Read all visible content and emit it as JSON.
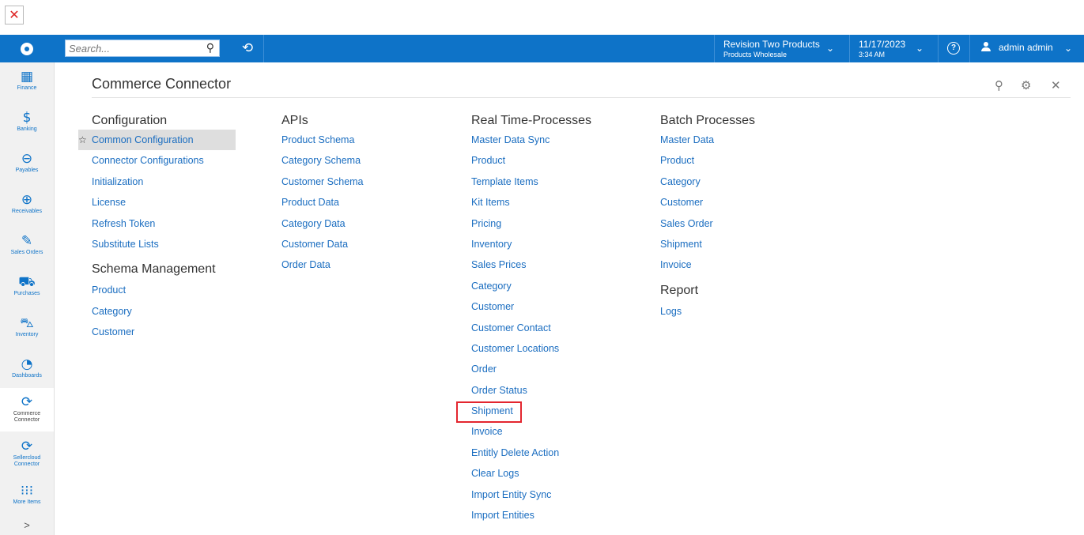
{
  "topbar": {
    "search_placeholder": "Search...",
    "company_name": "Revision Two Products",
    "company_branch": "Products Wholesale",
    "date": "11/17/2023",
    "time": "3:34 AM",
    "user_name": "admin admin",
    "brand_color": "#0e73c8"
  },
  "sidebar": {
    "items": [
      {
        "label": "Finance",
        "icon": "calculator-icon"
      },
      {
        "label": "Banking",
        "icon": "dollar-icon"
      },
      {
        "label": "Payables",
        "icon": "minus-circle-icon"
      },
      {
        "label": "Receivables",
        "icon": "plus-circle-icon"
      },
      {
        "label": "Sales Orders",
        "icon": "edit-icon"
      },
      {
        "label": "Purchases",
        "icon": "cart-icon"
      },
      {
        "label": "Inventory",
        "icon": "truck-icon"
      },
      {
        "label": "Dashboards",
        "icon": "gauge-icon"
      },
      {
        "label": "Commerce Connector",
        "icon": "sync-icon"
      },
      {
        "label": "Sellercloud Connector",
        "icon": "sync-icon"
      },
      {
        "label": "More Items",
        "icon": "grid-icon"
      }
    ],
    "expand_glyph": ">"
  },
  "page": {
    "title": "Commerce Connector"
  },
  "columns": [
    {
      "sections": [
        {
          "heading": "Configuration",
          "links": [
            "Common Configuration",
            "Connector Configurations",
            "Initialization",
            "License",
            "Refresh Token",
            "Substitute Lists"
          ]
        },
        {
          "heading": "Schema Management",
          "links": [
            "Product",
            "Category",
            "Customer"
          ]
        }
      ]
    },
    {
      "sections": [
        {
          "heading": "APIs",
          "links": [
            "Product Schema",
            "Category Schema",
            "Customer Schema",
            "Product Data",
            "Category Data",
            "Customer Data",
            "Order Data"
          ]
        }
      ]
    },
    {
      "sections": [
        {
          "heading": "Real Time-Processes",
          "links": [
            "Master Data Sync",
            "Product",
            "Template Items",
            "Kit Items",
            "Pricing",
            "Inventory",
            "Sales Prices",
            "Category",
            "Customer",
            "Customer Contact",
            "Customer Locations",
            "Order",
            "Order Status",
            "Shipment",
            "Invoice",
            "Entitly Delete Action",
            "Clear Logs",
            "Import Entity Sync",
            "Import Entities"
          ]
        }
      ]
    },
    {
      "sections": [
        {
          "heading": "Batch Processes",
          "links": [
            "Master Data",
            "Product",
            "Category",
            "Customer",
            "Sales Order",
            "Shipment",
            "Invoice"
          ]
        },
        {
          "heading": "Report",
          "links": [
            "Logs"
          ]
        }
      ]
    }
  ],
  "highlight_color": "#e3262f",
  "link_color": "#1a6dc0"
}
